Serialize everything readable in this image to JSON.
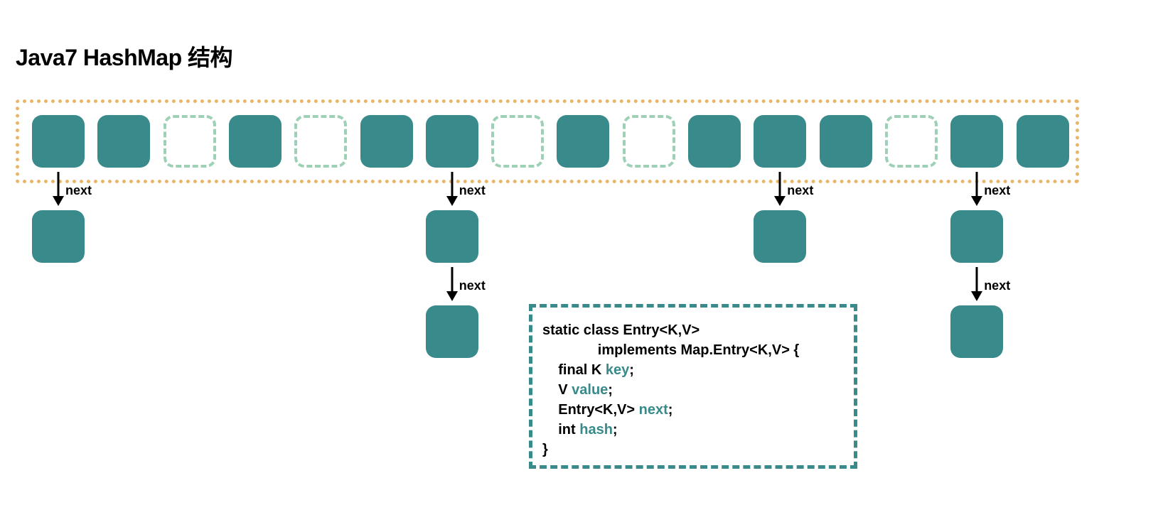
{
  "title": "Java7 HashMap 结构",
  "next_label": "next",
  "colors": {
    "bucket_fill": "#398a8a",
    "empty_border": "#9ed0b6",
    "array_border": "#e8b66b",
    "codebox_border": "#398a8a"
  },
  "buckets": [
    {
      "index": 0,
      "filled": true,
      "chain_length": 1
    },
    {
      "index": 1,
      "filled": true,
      "chain_length": 0
    },
    {
      "index": 2,
      "filled": false,
      "chain_length": 0
    },
    {
      "index": 3,
      "filled": true,
      "chain_length": 0
    },
    {
      "index": 4,
      "filled": false,
      "chain_length": 0
    },
    {
      "index": 5,
      "filled": true,
      "chain_length": 0
    },
    {
      "index": 6,
      "filled": true,
      "chain_length": 2
    },
    {
      "index": 7,
      "filled": false,
      "chain_length": 0
    },
    {
      "index": 8,
      "filled": true,
      "chain_length": 0
    },
    {
      "index": 9,
      "filled": false,
      "chain_length": 0
    },
    {
      "index": 10,
      "filled": true,
      "chain_length": 0
    },
    {
      "index": 11,
      "filled": true,
      "chain_length": 1
    },
    {
      "index": 12,
      "filled": true,
      "chain_length": 0
    },
    {
      "index": 13,
      "filled": false,
      "chain_length": 0
    },
    {
      "index": 14,
      "filled": true,
      "chain_length": 2
    },
    {
      "index": 15,
      "filled": true,
      "chain_length": 0
    }
  ],
  "code": {
    "line1_a": "static class Entry<K,V>",
    "line1_b": "implements Map.Entry<K,V> {",
    "line2_a": "final K ",
    "line2_b": "key",
    "line3_a": "V ",
    "line3_b": "value",
    "line4_a": "Entry<K,V> ",
    "line4_b": "next",
    "line5_a": "int ",
    "line5_b": "hash",
    "line6": "}",
    "semi": ";"
  }
}
